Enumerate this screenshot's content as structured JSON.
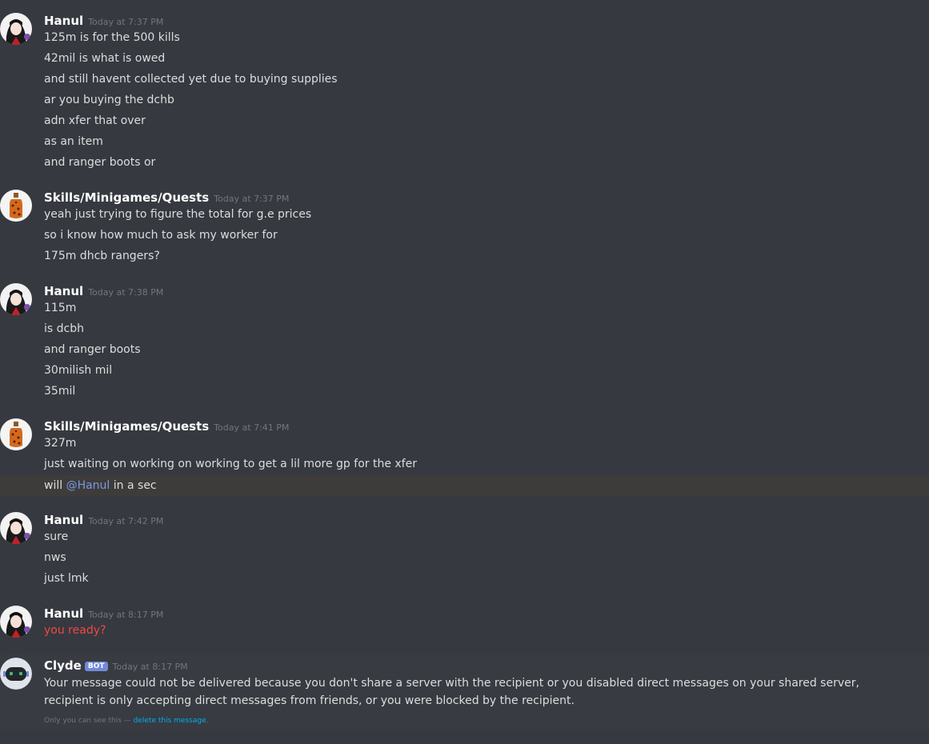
{
  "messages": [
    {
      "author": "Hanul",
      "timestamp": "Today at 7:37 PM",
      "avatar_icon": "anime-avatar-icon",
      "lines": [
        "125m is for the 500 kills",
        "42mil is what is owed",
        "and still havent collected yet due to buying supplies",
        "ar you buying the dchb",
        "adn xfer that over",
        "as an item",
        "and ranger boots or"
      ]
    },
    {
      "author": "Skills/Minigames/Quests",
      "timestamp": "Today at 7:37 PM",
      "avatar_icon": "bottle-avatar-icon",
      "lines": [
        "yeah just trying to figure the total for g.e prices",
        "so i know how much to ask my worker for",
        "175m dhcb rangers?"
      ]
    },
    {
      "author": "Hanul",
      "timestamp": "Today at 7:38 PM",
      "avatar_icon": "anime-avatar-icon",
      "lines": [
        "115m",
        "is dcbh",
        "and ranger boots",
        "30milish mil",
        "35mil"
      ]
    },
    {
      "author": "Skills/Minigames/Quests",
      "timestamp": "Today at 7:41 PM",
      "avatar_icon": "bottle-avatar-icon",
      "lines": [
        "327m",
        "just waiting on working on working to get a lil more gp for the xfer"
      ],
      "mention_line": {
        "before": "will ",
        "mention": "@Hanul",
        "after": " in a sec"
      }
    },
    {
      "author": "Hanul",
      "timestamp": "Today at 7:42 PM",
      "avatar_icon": "anime-avatar-icon",
      "lines": [
        "sure",
        "nws",
        "just lmk"
      ]
    },
    {
      "author": "Hanul",
      "timestamp": "Today at 8:17 PM",
      "avatar_icon": "anime-avatar-icon",
      "lines": [
        "you ready?"
      ]
    }
  ],
  "clyde": {
    "author": "Clyde",
    "bot_tag": "BOT",
    "timestamp": "Today at 8:17 PM",
    "avatar_icon": "clyde-bot-icon",
    "text": "Your message could not be delivered because you don't share a server with the recipient or you disabled direct messages on your shared server, recipient is only accepting direct messages from friends, or you were blocked by the recipient.",
    "notice": "Only you can see this — ",
    "delete_link": "delete this message",
    "notice_end": "."
  },
  "colors": {
    "background": "#36393f",
    "error_text": "#f04747",
    "mention": "#7c97e2",
    "bot_tag": "#7289da",
    "link": "#00b0f4"
  }
}
